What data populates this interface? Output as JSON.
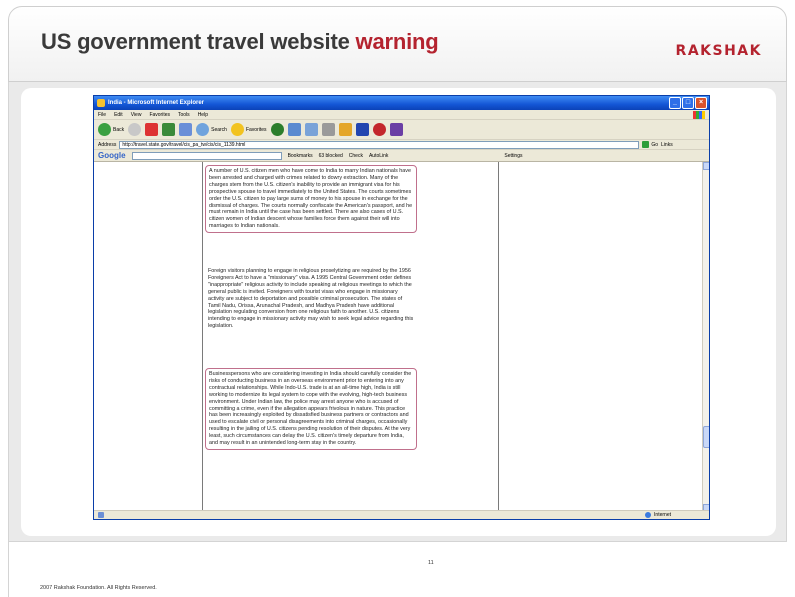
{
  "slide": {
    "title_main": "US government travel website",
    "title_highlight": "warning",
    "brand": "RAKSHAK",
    "footer": "2007 Rakshak Foundation. All Rights Reserved.",
    "page_number": "11"
  },
  "browser": {
    "window_title": "India - Microsoft Internet Explorer",
    "menu": [
      "File",
      "Edit",
      "View",
      "Favorites",
      "Tools",
      "Help"
    ],
    "toolbar": {
      "back": "Back",
      "search": "Search",
      "favorites": "Favorites"
    },
    "address_label": "Address",
    "address_value": "http://travel.state.gov/travel/cis_pa_tw/cis/cis_1139.html",
    "go_label": "Go",
    "links_label": "Links",
    "google_bar": {
      "logo": "Google",
      "bookmarks": "Bookmarks",
      "blocked": "63 blocked",
      "check": "Check",
      "autolink": "AutoLink",
      "settings": "Settings"
    },
    "status_zone": "Internet"
  },
  "content": {
    "para1": "A number of U.S. citizen men who have come to India to marry Indian nationals have been arrested and charged with crimes related to dowry extraction. Many of the charges stem from the U.S. citizen's inability to provide an immigrant visa for his prospective spouse to travel immediately to the United States. The courts sometimes order the U.S. citizen to pay large sums of money to his spouse in exchange for the dismissal of charges. The courts normally confiscate the American's passport, and he must remain in India until the case has been settled. There are also cases of U.S. citizen women of Indian descent whose families force them against their will into marriages to Indian nationals.",
    "para2": "Foreign visitors planning to engage in religious proselytizing are required by the 1956 Foreigners Act to have a \"missionary\" visa. A 1995 Central Government order defines \"inappropriate\" religious activity to include speaking at religious meetings to which the general public is invited. Foreigners with tourist visas who engage in missionary activity are subject to deportation and possible criminal prosecution. The states of Tamil Nadu, Orissa, Arunachal Pradesh, and Madhya Pradesh have additional legislation regulating conversion from one religious faith to another. U.S. citizens intending to engage in missionary activity may wish to seek legal advice regarding this legislation.",
    "para3": "Businesspersons who are considering investing in India should carefully consider the risks of conducting business in an overseas environment prior to entering into any contractual relationships. While Indo-U.S. trade is at an all-time high, India is still working to modernize its legal system to cope with the evolving, high-tech business environment. Under Indian law, the police may arrest anyone who is accused of committing a crime, even if the allegation appears frivolous in nature. This practice has been increasingly exploited by dissatisfied business partners or contractors and used to escalate civil or personal disagreements into criminal charges, occasionally resulting in the jailing of U.S. citizens pending resolution of their disputes. At the very least, such circumstances can delay the U.S. citizen's timely departure from India, and may result in an unintended long-term stay in the country."
  }
}
